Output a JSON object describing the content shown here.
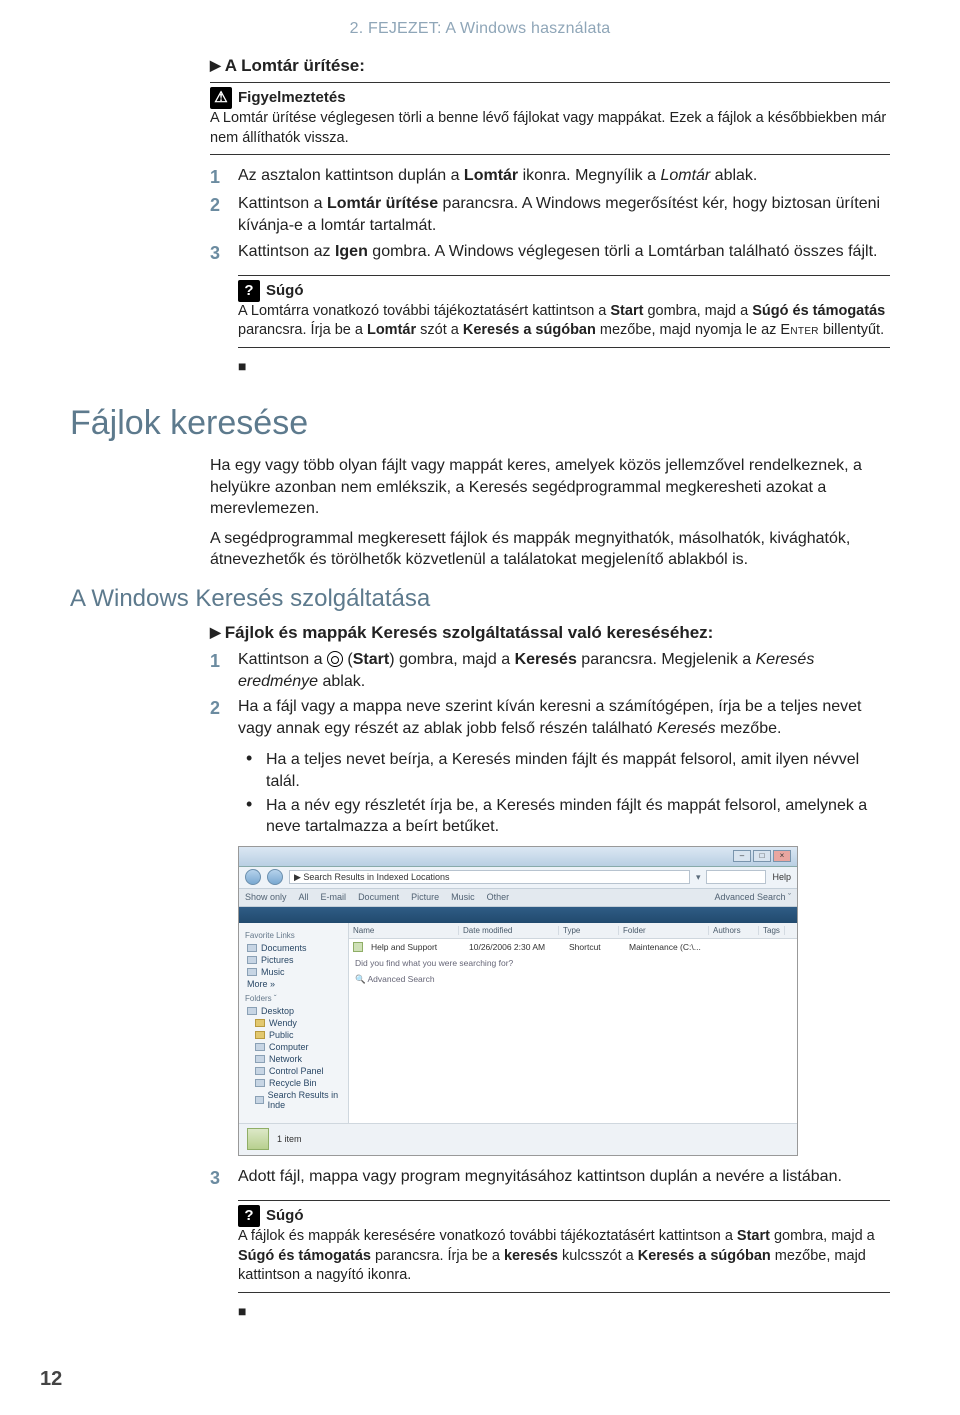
{
  "chapter": "2. FEJEZET: A Windows használata",
  "sec1": {
    "heading": "A Lomtár ürítése:",
    "warn_title": "Figyelmeztetés",
    "warn_body": "A Lomtár ürítése véglegesen törli a benne lévő fájlokat vagy mappákat. Ezek a fájlok a későbbiekben már nem állíthatók vissza.",
    "steps": {
      "s1a": "Az asztalon kattintson duplán a ",
      "s1b": "Lomtár",
      "s1c": " ikonra. Megnyílik a ",
      "s1d": "Lomtár",
      "s1e": " ablak.",
      "s2a": "Kattintson a ",
      "s2b": "Lomtár ürítése",
      "s2c": " parancsra. A Windows megerősítést kér, hogy biztosan üríteni kívánja-e a lomtár tartalmát.",
      "s3a": "Kattintson az ",
      "s3b": "Igen",
      "s3c": " gombra. A Windows véglegesen törli a Lomtárban található összes fájlt."
    },
    "help_title": "Súgó",
    "help_a": "A Lomtárra vonatkozó további tájékoztatásért kattintson a ",
    "help_b": "Start",
    "help_c": " gombra, majd a ",
    "help_d": "Súgó és támogatás",
    "help_e": " parancsra. Írja be a ",
    "help_f": "Lomtár",
    "help_g": " szót a ",
    "help_h": "Keresés a súgóban",
    "help_i": " mezőbe, majd nyomja le az ",
    "help_j": "Enter",
    "help_k": " billentyűt."
  },
  "h1": "Fájlok keresése",
  "p1": "Ha egy vagy több olyan fájlt vagy mappát keres, amelyek közös jellemzővel rendelkeznek, a helyükre azonban nem emlékszik, a Keresés segédprogrammal megkeresheti azokat a merevlemezen.",
  "p2": "A segédprogrammal megkeresett fájlok és mappák megnyithatók, másolhatók, kivághatók, átnevezhetők és törölhetők közvetlenül a találatokat megjelenítő ablakból is.",
  "h2": "A Windows Keresés szolgáltatása",
  "sec2": {
    "heading": "Fájlok és mappák Keresés szolgáltatással való kereséséhez:",
    "s1a": "Kattintson a ",
    "s1b": " (",
    "s1c": "Start",
    "s1d": ") gombra, majd a ",
    "s1e": "Keresés",
    "s1f": " parancsra. Megjelenik a ",
    "s1g": "Keresés eredménye",
    "s1h": " ablak.",
    "s2a": "Ha a fájl vagy a mappa neve szerint kíván keresni a számítógépen, írja be a teljes nevet vagy annak egy részét az ablak jobb felső részén található ",
    "s2b": "Keresés",
    "s2c": " mezőbe.",
    "b1": "Ha a teljes nevet beírja, a Keresés minden fájlt és mappát felsorol, amit ilyen névvel talál.",
    "b2": "Ha a név egy részletét írja be, a Keresés minden fájlt és mappát felsorol, amelynek a neve tartalmazza a beírt betűket.",
    "s3": "Adott fájl, mappa vagy program megnyitásához kattintson duplán a nevére a listában."
  },
  "help2": {
    "title": "Súgó",
    "a": "A fájlok és mappák keresésére vonatkozó további tájékoztatásért kattintson a ",
    "b": "Start",
    "c": " gombra, majd a ",
    "d": "Súgó és támogatás",
    "e": " parancsra. Írja be a ",
    "f": "keresés",
    "g": " kulcsszót a ",
    "h": "Keresés a súgóban",
    "i": " mezőbe, majd kattintson a nagyító ikonra."
  },
  "shot": {
    "addr": "Search Results in Indexed Locations",
    "search_ph": "Help",
    "toolbar": {
      "showonly": "Show only",
      "all": "All",
      "email": "E-mail",
      "doc": "Document",
      "pic": "Picture",
      "music": "Music",
      "other": "Other",
      "adv": "Advanced Search",
      "chev": "ˇ"
    },
    "filter": {
      "label": ""
    },
    "side": {
      "fav": "Favorite Links",
      "docs": "Documents",
      "pics": "Pictures",
      "music": "Music",
      "more": "More »",
      "folders": "Folders",
      "desktop": "Desktop",
      "wendy": "Wendy",
      "public": "Public",
      "computer": "Computer",
      "network": "Network",
      "cp": "Control Panel",
      "rb": "Recycle Bin",
      "sr": "Search Results in Inde"
    },
    "cols": {
      "name": "Name",
      "date": "Date modified",
      "type": "Type",
      "folder": "Folder",
      "authors": "Authors",
      "tags": "Tags"
    },
    "row": {
      "name": "Help and Support",
      "date": "10/26/2006 2:30 AM",
      "type": "Shortcut",
      "folder": "Maintenance (C:\\..."
    },
    "hint1": "Did you find what you were searching for?",
    "hint2": "Advanced Search",
    "status": "1 item"
  },
  "pagenum": "12",
  "end_square": "■"
}
